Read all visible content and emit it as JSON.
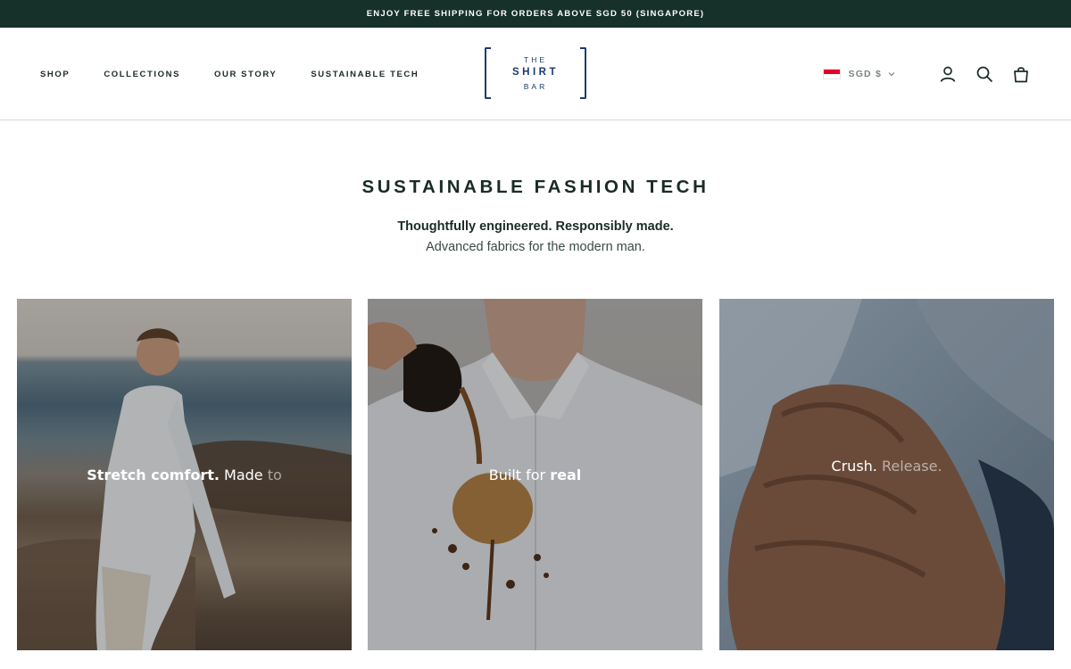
{
  "announcement": {
    "text": "ENJOY FREE SHIPPING FOR ORDERS ABOVE SGD 50 (SINGAPORE)"
  },
  "nav": {
    "items": [
      {
        "label": "SHOP"
      },
      {
        "label": "COLLECTIONS"
      },
      {
        "label": "OUR STORY"
      },
      {
        "label": "SUSTAINABLE TECH"
      }
    ]
  },
  "logo": {
    "line1": "THE",
    "line2": "SHIRT",
    "line3": "BAR"
  },
  "currency": {
    "label": "SGD $",
    "flag": "singapore-flag"
  },
  "icons": {
    "account": "user-icon",
    "search": "search-icon",
    "cart": "bag-icon"
  },
  "colors": {
    "announce_bg": "#16302a",
    "logo": "#1a3b6e",
    "text": "#1a2b24"
  },
  "hero": {
    "title": "SUSTAINABLE FASHION TECH",
    "subtitle_bold": "Thoughtfully engineered. Responsibly made.",
    "subtitle": "Advanced fabrics for the modern man."
  },
  "cards": [
    {
      "strong": "Stretch comfort.",
      "normal": " Made ",
      "fade": "to"
    },
    {
      "strong_after": "real",
      "normal": "Built for "
    },
    {
      "strong": "Crush.",
      "fade": " Release."
    }
  ]
}
